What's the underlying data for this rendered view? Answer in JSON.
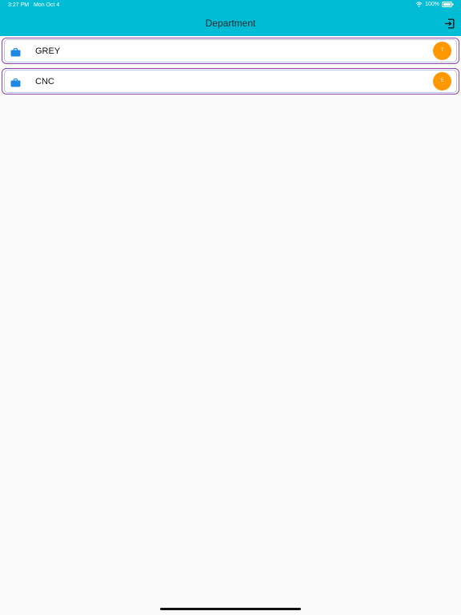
{
  "status_bar": {
    "time": "3:27 PM",
    "date": "Mon Oct 4",
    "battery": "100%"
  },
  "app_bar": {
    "title": "Department",
    "logout_icon": "logout-icon",
    "background_color": "#00bcd4"
  },
  "departments": [
    {
      "name": "GREY",
      "count": "7",
      "icon": "briefcase-icon"
    },
    {
      "name": "CNC",
      "count": "5",
      "icon": "briefcase-icon"
    }
  ],
  "colors": {
    "accent": "#00bcd4",
    "badge": "#ff9800",
    "icon": "#1e88e5",
    "row_border": "#8e44ad"
  }
}
